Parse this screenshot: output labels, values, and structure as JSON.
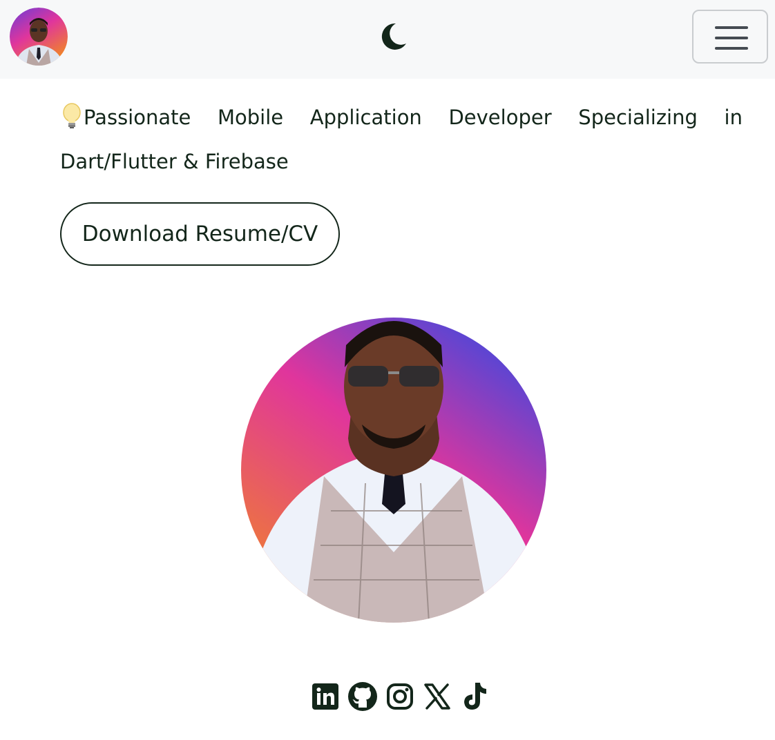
{
  "navbar": {
    "avatar_alt": "Profile photo",
    "theme_toggle_icon": "moon-icon",
    "menu_icon": "hamburger-menu-icon"
  },
  "hero": {
    "tagline_text": "Passionate Mobile Application Developer Specializing in Dart/Flutter & Firebase",
    "tagline_emoji_icon": "lightbulb-icon",
    "resume_button_label": "Download Resume/CV",
    "portrait_alt": "Portrait photo"
  },
  "socials": [
    {
      "icon": "linkedin-icon"
    },
    {
      "icon": "github-icon"
    },
    {
      "icon": "instagram-icon"
    },
    {
      "icon": "x-icon"
    },
    {
      "icon": "tiktok-icon"
    }
  ],
  "colors": {
    "text": "#13261a",
    "navbar_bg": "#f7f8f9",
    "gradient_top": "#3b49e0",
    "gradient_mid": "#e0359c",
    "gradient_bottom": "#f0832a"
  }
}
